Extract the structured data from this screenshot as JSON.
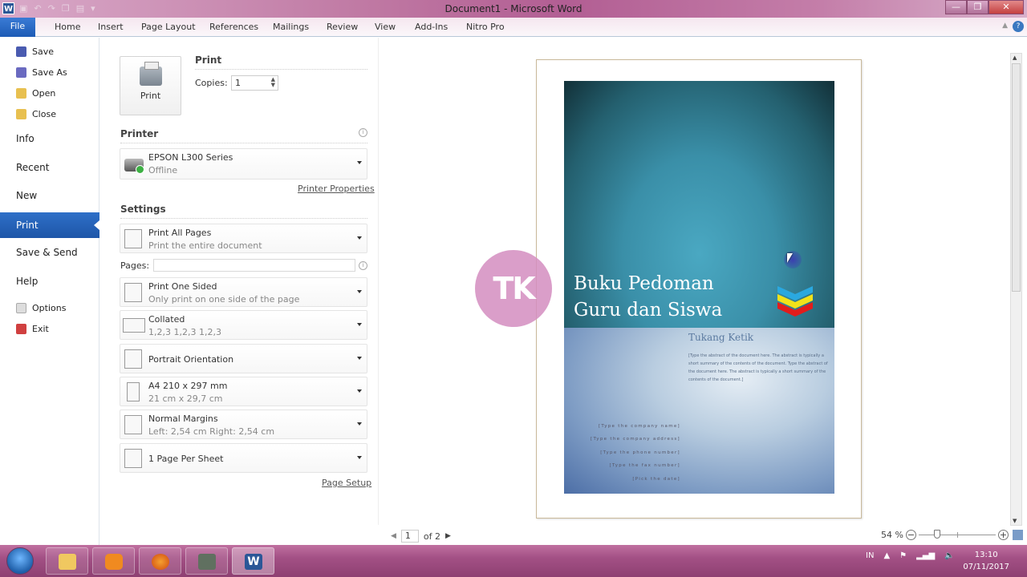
{
  "window": {
    "title": "Document1 - Microsoft Word",
    "app_icon": "W",
    "controls": {
      "minimize": "—",
      "restore": "❐",
      "close": "✕"
    }
  },
  "quick_access": [
    "save-icon",
    "undo-icon",
    "redo-icon",
    "copy-icon",
    "paste-icon",
    "customize-icon"
  ],
  "ribbon": {
    "file_tab": "File",
    "tabs": [
      "Home",
      "Insert",
      "Page Layout",
      "References",
      "Mailings",
      "Review",
      "View",
      "Add-Ins",
      "Nitro Pro"
    ],
    "help": "?"
  },
  "backstage": {
    "commands": [
      {
        "label": "Save",
        "icon": "save-icon",
        "color": "#4a5bb0"
      },
      {
        "label": "Save As",
        "icon": "save-as-icon",
        "color": "#6a6ac0"
      },
      {
        "label": "Open",
        "icon": "open-folder-icon",
        "color": "#e8c050"
      },
      {
        "label": "Close",
        "icon": "close-folder-icon",
        "color": "#e8c050"
      }
    ],
    "sections": [
      "Info",
      "Recent",
      "New",
      "Print",
      "Save & Send",
      "Help"
    ],
    "selected": "Print",
    "footer": [
      {
        "label": "Options",
        "icon": "options-icon",
        "color": "#ccc"
      },
      {
        "label": "Exit",
        "icon": "exit-icon",
        "color": "#d04040"
      }
    ]
  },
  "print": {
    "button_label": "Print",
    "heading": "Print",
    "copies_label": "Copies:",
    "copies_value": "1",
    "printer_heading": "Printer",
    "printer_name": "EPSON L300 Series",
    "printer_status": "Offline",
    "printer_properties": "Printer Properties",
    "settings_heading": "Settings",
    "settings": [
      {
        "title": "Print All Pages",
        "subtitle": "Print the entire document"
      },
      {
        "title": "Print One Sided",
        "subtitle": "Only print on one side of the page"
      },
      {
        "title": "Collated",
        "subtitle": "1,2,3    1,2,3    1,2,3"
      },
      {
        "title": "Portrait Orientation",
        "subtitle": ""
      },
      {
        "title": "A4 210 x 297 mm",
        "subtitle": "21 cm x 29,7 cm"
      },
      {
        "title": "Normal Margins",
        "subtitle": "Left:  2,54 cm    Right:  2,54 cm"
      },
      {
        "title": "1 Page Per Sheet",
        "subtitle": ""
      }
    ],
    "pages_label": "Pages:",
    "pages_value": "",
    "page_setup": "Page Setup"
  },
  "preview": {
    "cover_title_line1": "Buku Pedoman",
    "cover_title_line2": "Guru dan Siswa",
    "author": "Tukang Ketik",
    "abstract": "[Type the abstract of the document here. The abstract is typically a short summary of the contents of the document. Type the abstract of the document here. The abstract is typically a short summary of the contents of the document.]",
    "contact": [
      "[Type the company name]",
      "[Type the company address]",
      "[Type the phone number]",
      "[Type the fax number]",
      "[Pick the date]"
    ],
    "chevron_colors": [
      "#2aa8e0",
      "#f2e21a",
      "#e21c1c"
    ],
    "watermark": "TK",
    "current_page": "1",
    "page_of": "of 2",
    "zoom_label": "54 %",
    "zoom_percent": 54
  },
  "taskbar": {
    "apps": [
      {
        "name": "file-explorer",
        "color": "#f0c860"
      },
      {
        "name": "media-player",
        "color": "#f08a20"
      },
      {
        "name": "firefox",
        "color": "#e86a20"
      },
      {
        "name": "app-4",
        "color": "#607060"
      },
      {
        "name": "word",
        "color": "#2b5797",
        "active": true
      }
    ],
    "language": "IN",
    "time": "13:10",
    "date": "07/11/2017"
  }
}
